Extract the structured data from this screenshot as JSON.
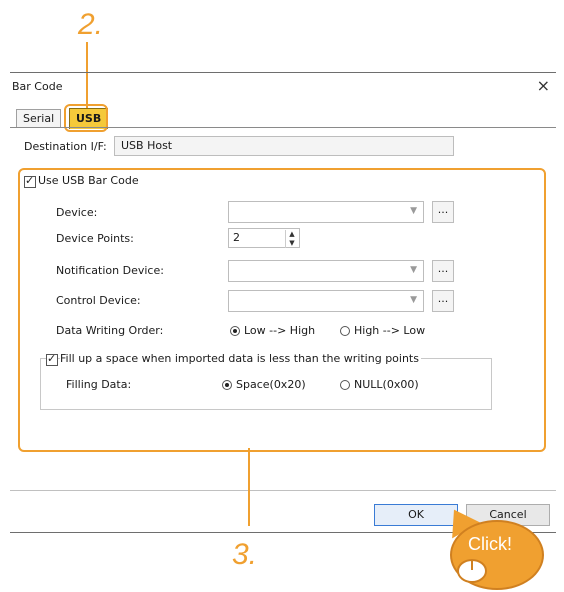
{
  "callouts": {
    "step2": "2.",
    "step3": "3."
  },
  "dialog": {
    "title": "Bar Code",
    "close_glyph": "×",
    "tabs": [
      {
        "label": "Serial"
      },
      {
        "label": "USB"
      }
    ],
    "destination": {
      "label": "Destination I/F:",
      "value": "USB Host"
    },
    "use_usb": {
      "label": "Use USB Bar Code",
      "checked": true
    },
    "device": {
      "label": "Device:",
      "value": "",
      "more": "..."
    },
    "device_points": {
      "label": "Device Points:",
      "value": "2"
    },
    "notification_device": {
      "label": "Notification Device:",
      "value": "",
      "more": "..."
    },
    "control_device": {
      "label": "Control Device:",
      "value": "",
      "more": "..."
    },
    "data_writing_order": {
      "label": "Data Writing Order:",
      "options": [
        {
          "label": "Low --> High",
          "selected": true
        },
        {
          "label": "High --> Low",
          "selected": false
        }
      ]
    },
    "fill_up": {
      "label": "Fill up a space when imported data is less than the writing points",
      "checked": true
    },
    "filling_data": {
      "label": "Filling Data:",
      "options": [
        {
          "label": "Space(0x20)",
          "selected": true
        },
        {
          "label": "NULL(0x00)",
          "selected": false
        }
      ]
    },
    "buttons": {
      "ok": "OK",
      "cancel": "Cancel"
    }
  },
  "click_label": "Click!",
  "colors": {
    "accent": "#f0a030",
    "tab_highlight": "#f5c93a"
  }
}
